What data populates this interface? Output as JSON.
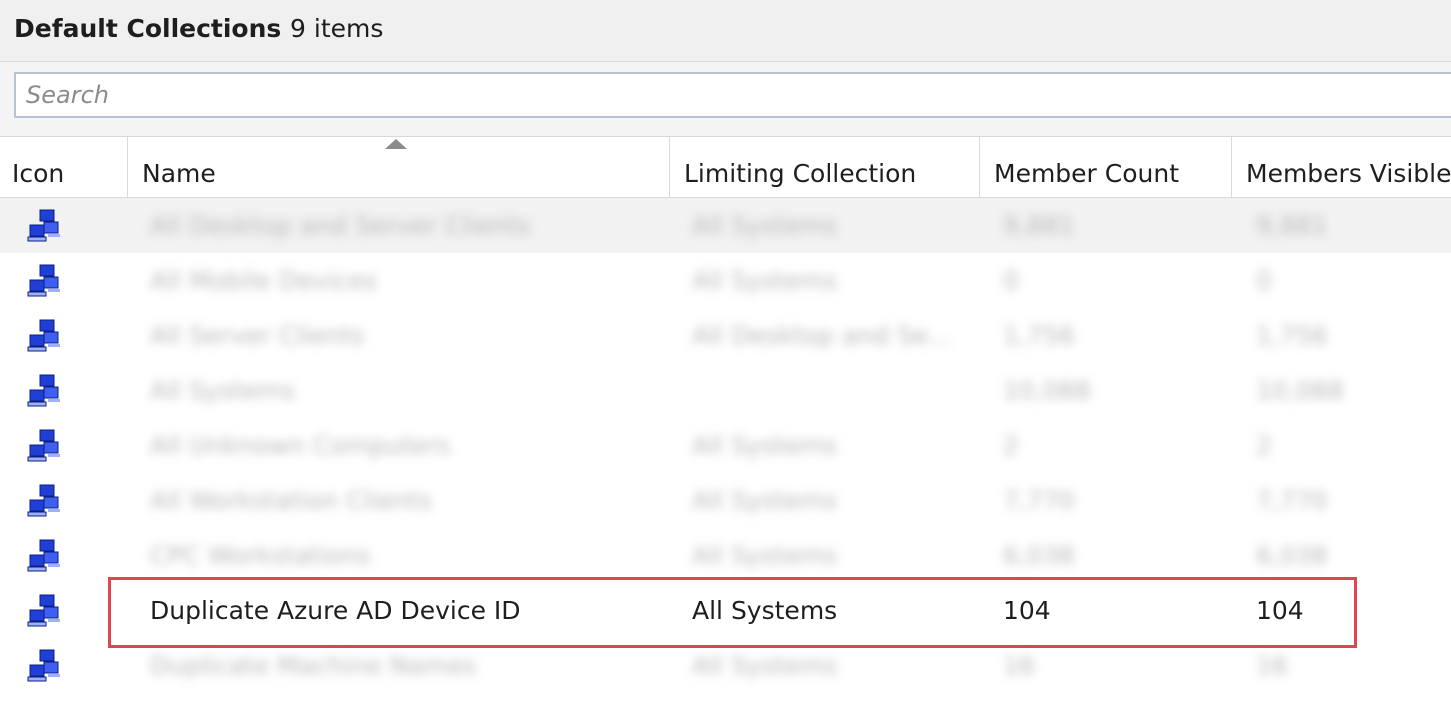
{
  "header": {
    "title": "Default Collections",
    "item_count": "9 items"
  },
  "search": {
    "placeholder": "Search",
    "value": ""
  },
  "columns": [
    {
      "label": "Icon"
    },
    {
      "label": "Name"
    },
    {
      "label": "Limiting Collection"
    },
    {
      "label": "Member Count"
    },
    {
      "label": "Members Visible"
    }
  ],
  "sort": {
    "column": "Name",
    "direction": "ascending"
  },
  "rows": [
    {
      "name": "All Desktop and Server Clients",
      "limiting": "All Systems",
      "member_count": "9,881",
      "members_visible": "9,881",
      "obscured": true
    },
    {
      "name": "All Mobile Devices",
      "limiting": "All Systems",
      "member_count": "0",
      "members_visible": "0",
      "obscured": true
    },
    {
      "name": "All Server Clients",
      "limiting": "All Desktop and Se...",
      "member_count": "1,756",
      "members_visible": "1,756",
      "obscured": true
    },
    {
      "name": "All Systems",
      "limiting": "",
      "member_count": "10,088",
      "members_visible": "10,088",
      "obscured": true
    },
    {
      "name": "All Unknown Computers",
      "limiting": "All Systems",
      "member_count": "2",
      "members_visible": "2",
      "obscured": true
    },
    {
      "name": "All Workstation Clients",
      "limiting": "All Systems",
      "member_count": "7,770",
      "members_visible": "7,770",
      "obscured": true
    },
    {
      "name": "CPC Workstations",
      "limiting": "All Systems",
      "member_count": "6,038",
      "members_visible": "6,038",
      "obscured": true
    },
    {
      "name": "Duplicate Azure AD Device ID",
      "limiting": "All Systems",
      "member_count": "104",
      "members_visible": "104",
      "obscured": false,
      "highlighted": true
    },
    {
      "name": "Duplicate Machine Names",
      "limiting": "All Systems",
      "member_count": "16",
      "members_visible": "16",
      "obscured": true
    }
  ],
  "colors": {
    "highlight_border": "#e0444e",
    "icon_blue": "#1f3fd6"
  },
  "icon": "collection-icon"
}
